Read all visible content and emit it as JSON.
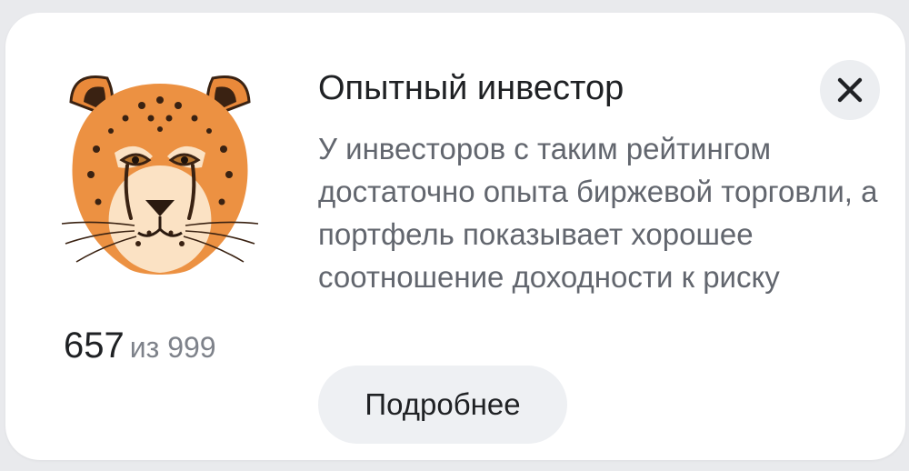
{
  "card": {
    "title": "Опытный инвестор",
    "description": "У инвесторов с таким рейтингом достаточно опыта биржевой торговли, а портфель показывает хорошее соотношение доходности к риску",
    "close_icon": "close-icon",
    "details_button_label": "Подробнее"
  },
  "rating": {
    "value": "657",
    "suffix": "из 999",
    "avatar_icon": "cheetah-icon"
  },
  "colors": {
    "background": "#e9eaed",
    "card": "#ffffff",
    "title_text": "#1f2124",
    "body_text": "#62666e",
    "button_bg": "#eef0f3",
    "cheetah_orange": "#e98a3b"
  }
}
